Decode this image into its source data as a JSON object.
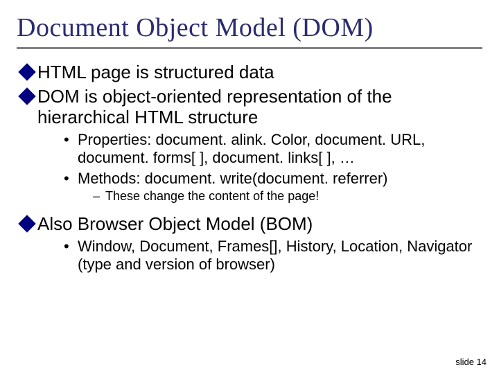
{
  "title": "Document Object Model (DOM)",
  "bullets": {
    "b1": "HTML page is structured data",
    "b2": "DOM is object-oriented representation of the hierarchical HTML structure",
    "b2_sub1": "Properties:  document. alink. Color, document. URL, document. forms[ ], document. links[ ], …",
    "b2_sub2": "Methods:  document. write(document. referrer)",
    "b2_sub2_note": "These change the content of the page!",
    "b3": "Also Browser Object Model (BOM)",
    "b3_sub1": "Window, Document, Frames[], History, Location, Navigator (type and version of browser)"
  },
  "footer": "slide 14"
}
